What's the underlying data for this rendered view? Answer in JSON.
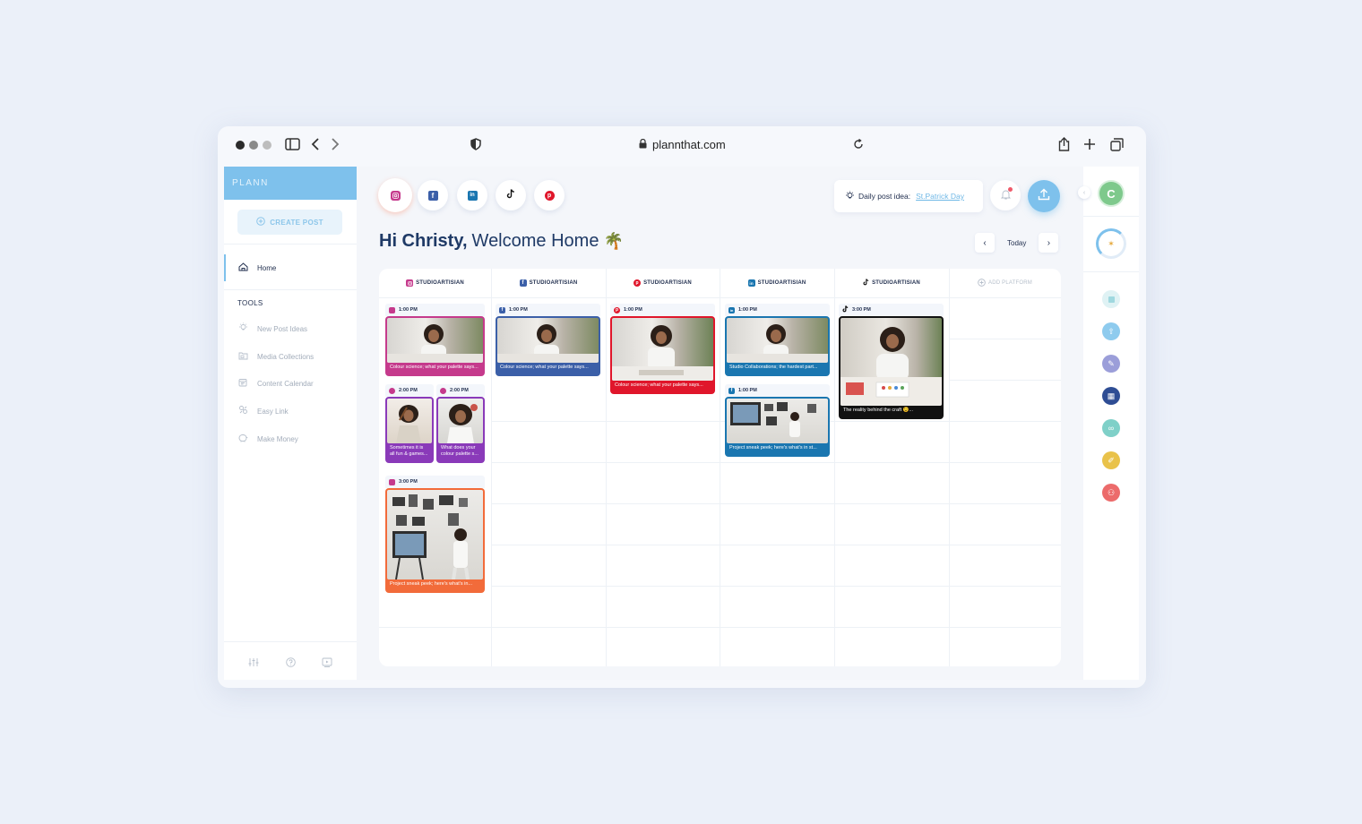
{
  "browser": {
    "url": "plannthat.com"
  },
  "sidebar": {
    "brand": "PLANN",
    "create_post": "CREATE POST",
    "home": "Home",
    "tools_title": "TOOLS",
    "tools": [
      {
        "label": "New Post Ideas",
        "icon": "lightbulb-icon"
      },
      {
        "label": "Media Collections",
        "icon": "folder-icon"
      },
      {
        "label": "Content Calendar",
        "icon": "calendar-icon"
      },
      {
        "label": "Easy Link",
        "icon": "link-icon"
      },
      {
        "label": "Make Money",
        "icon": "piggy-bank-icon"
      }
    ]
  },
  "header": {
    "platforms": [
      "instagram",
      "facebook",
      "linkedin",
      "tiktok",
      "pinterest"
    ],
    "idea_label": "Daily post idea:",
    "idea_link": "St.Patrick Day"
  },
  "welcome": {
    "name": "Hi Christy,",
    "rest": "Welcome Home",
    "emoji": "🌴"
  },
  "date_nav": {
    "today": "Today"
  },
  "calendar": {
    "columns": [
      {
        "platform": "instagram",
        "account": "STUDIOARTISIAN"
      },
      {
        "platform": "facebook",
        "account": "STUDIOARTISIAN"
      },
      {
        "platform": "pinterest",
        "account": "STUDIOARTISIAN"
      },
      {
        "platform": "linkedin",
        "account": "STUDIOARTISIAN"
      },
      {
        "platform": "tiktok",
        "account": "STUDIOARTISIAN"
      }
    ],
    "add_platform": "ADD PLATFORM",
    "posts": [
      {
        "time": "1:00 PM",
        "caption": "Colour science; what your palette says..."
      },
      {
        "time": "2:00 PM",
        "caption": "Sometimes it is all fun & games..."
      },
      {
        "time": "2:00 PM",
        "caption": "What does your colour palette s..."
      },
      {
        "time": "3:00 PM",
        "caption": "Project sneak peek; here's what's in..."
      },
      {
        "time": "1:00 PM",
        "caption": "Colour science; what your palette says..."
      },
      {
        "time": "1:00 PM",
        "caption": "Colour science; what your palette says..."
      },
      {
        "time": "1:00 PM",
        "caption": "Studio Collaborations; the hardest part..."
      },
      {
        "time": "1:00 PM",
        "caption": "Project sneak peek; here's what's in st..."
      },
      {
        "time": "3:00 PM",
        "caption": "The reality behind the craft 😉..."
      }
    ]
  },
  "colors": {
    "brand": "#7ec1ec",
    "instagram": "#c53a8c",
    "facebook": "#3b5fa8",
    "pinterest": "#e0162b",
    "linkedin": "#1a76b0",
    "tiktok": "#111111",
    "story": "#8a3ab9",
    "reel": "#f26b3a"
  }
}
